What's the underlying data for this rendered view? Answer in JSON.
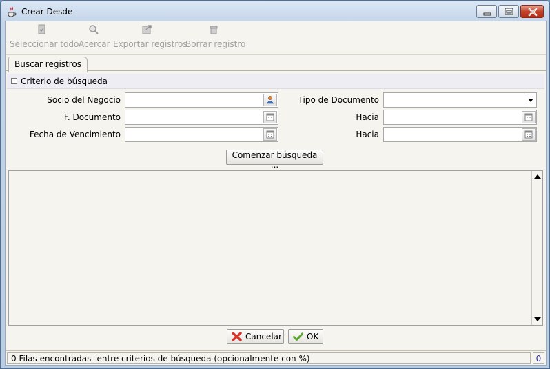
{
  "window": {
    "title": "Crear Desde"
  },
  "toolbar": {
    "select_all": "Seleccionar todo",
    "zoom": "Acercar",
    "export": "Exportar registros",
    "delete": "Borrar registro"
  },
  "tabs": [
    {
      "label": "Buscar registros",
      "active": true
    }
  ],
  "criteria": {
    "title": "Criterio de búsqueda",
    "business_partner_label": "Socio del Negocio",
    "business_partner_value": "",
    "doc_date_label": "F. Documento",
    "doc_date_value": "",
    "due_date_label": "Fecha de Vencimiento",
    "due_date_value": "",
    "doc_type_label": "Tipo de Documento",
    "doc_type_value": "",
    "to_label_1": "Hacia",
    "to_value_1": "",
    "to_label_2": "Hacia",
    "to_value_2": "",
    "search_button": "Comenzar búsqueda ..."
  },
  "actions": {
    "cancel": "Cancelar",
    "ok": "OK"
  },
  "status": {
    "message": "0 Filas encontradas- entre criterios de búsqueda (opcionalmente con %)",
    "count": "0"
  },
  "colors": {
    "background": "#f6f4ee",
    "disabled_text": "#a0a0a0",
    "cancel_icon": "#d9332a",
    "ok_icon": "#5aa52c",
    "count_text": "#2a2a9c"
  }
}
